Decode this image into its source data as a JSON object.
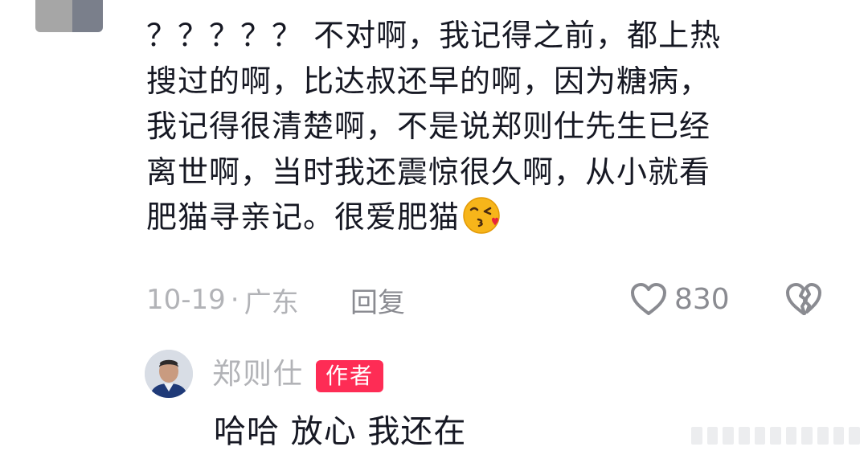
{
  "comment": {
    "lines": [
      "？？？？？ 不对啊，我记得之前，都上热",
      "搜过的啊，比达叔还早的啊，因为糖病，",
      "我记得很清楚啊，不是说郑则仕先生已经",
      "离世啊，当时我还震惊很久啊，从小就看",
      "肥猫寻亲记。很爱肥猫"
    ],
    "emoji_icon": "kissing-face-with-heart-emoji",
    "date": "10-19",
    "separator": "·",
    "location": "广东",
    "reply_label": "回复",
    "like_count": "830",
    "like_icon": "heart-outline-icon",
    "dislike_icon": "broken-heart-icon"
  },
  "reply": {
    "author_name": "郑则仕",
    "author_badge": "作者",
    "text": "哈哈 放心 我还在"
  },
  "colors": {
    "accent": "#fe2c55",
    "primary_text": "#161823",
    "secondary_text": "#b2b3b7"
  }
}
